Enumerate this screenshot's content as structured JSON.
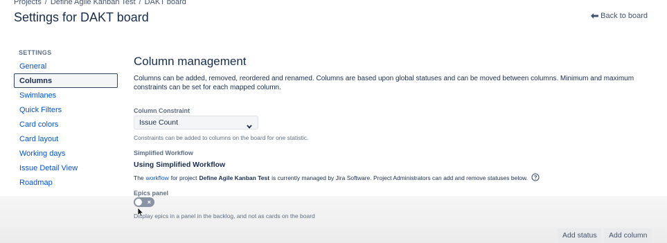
{
  "breadcrumb": {
    "items": [
      "Projects",
      "Define Agile Kanban Test",
      "DAKT board"
    ],
    "separator": "/"
  },
  "page_title": "Settings for DAKT board",
  "back_link": "Back to board",
  "sidebar": {
    "heading": "SETTINGS",
    "items": [
      {
        "label": "General",
        "active": false
      },
      {
        "label": "Columns",
        "active": true
      },
      {
        "label": "Swimlanes",
        "active": false
      },
      {
        "label": "Quick Filters",
        "active": false
      },
      {
        "label": "Card colors",
        "active": false
      },
      {
        "label": "Card layout",
        "active": false
      },
      {
        "label": "Working days",
        "active": false
      },
      {
        "label": "Issue Detail View",
        "active": false
      },
      {
        "label": "Roadmap",
        "active": false
      }
    ]
  },
  "main": {
    "title": "Column management",
    "intro": "Columns can be added, removed, reordered and renamed. Columns are based upon global statuses and can be moved between columns. Minimum and maximum constraints can be set for each mapped column.",
    "constraint": {
      "label": "Column Constraint",
      "selected": "Issue Count",
      "help": "Constraints can be added to columns on the board for one statistic."
    },
    "workflow": {
      "label": "Simplified Workflow",
      "heading": "Using Simplified Workflow",
      "text_before": "The",
      "link": "workflow",
      "text_mid": "for project",
      "project": "Define Agile Kanban Test",
      "text_after": "is currently managed by Jira Software. Project Administrators can add and remove statuses below."
    },
    "epics": {
      "label": "Epics panel",
      "enabled": false,
      "help": "Display epics in a panel in the backlog, and not as cards on the board"
    }
  },
  "buttons": {
    "add_status": "Add status",
    "add_column": "Add column"
  },
  "colors": {
    "link": "#0052cc",
    "text": "#172b4d",
    "toggle_off": "#8993a4"
  }
}
